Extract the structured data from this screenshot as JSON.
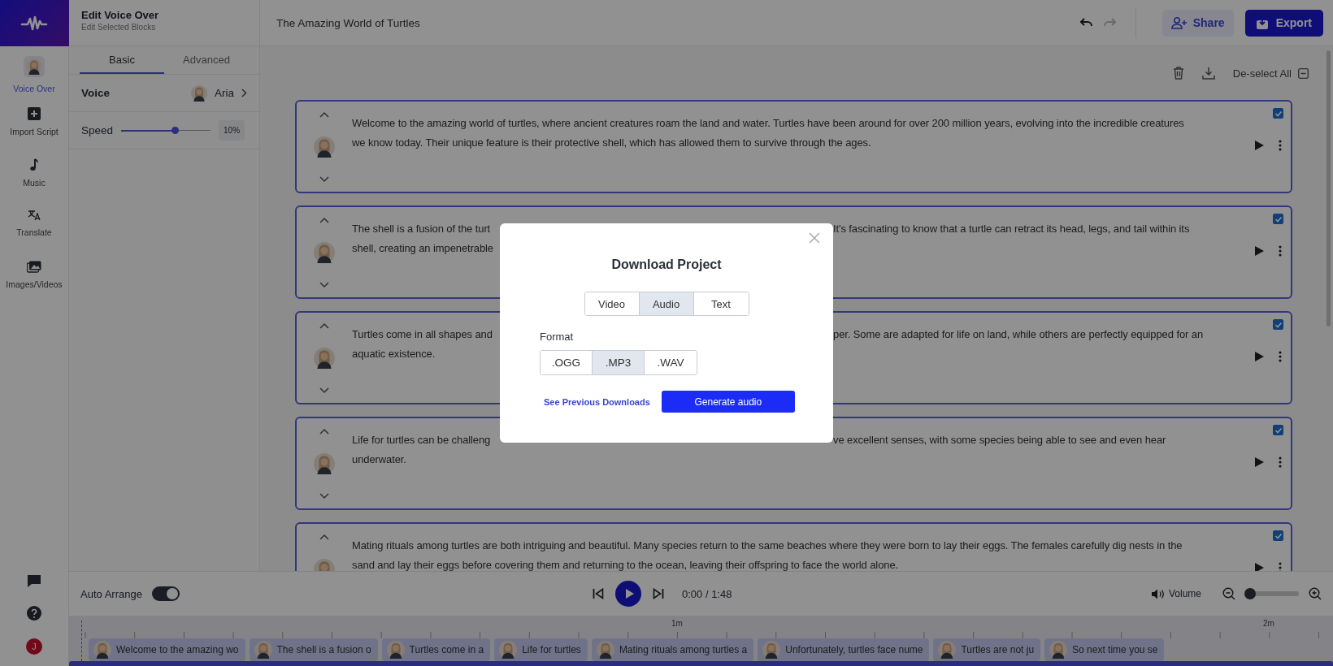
{
  "rail": [
    {
      "label": "Voice Over",
      "kind": "avatar",
      "selected": true
    },
    {
      "label": "Import Script",
      "kind": "plus",
      "selected": false
    },
    {
      "label": "Music",
      "kind": "note",
      "selected": false
    },
    {
      "label": "Translate",
      "kind": "translate",
      "selected": false
    },
    {
      "label": "Images/Videos",
      "kind": "images",
      "selected": false
    }
  ],
  "user_initial": "J",
  "panel": {
    "title": "Edit Voice Over",
    "subtitle": "Edit Selected Blocks",
    "tabs": [
      {
        "label": "Basic",
        "selected": true
      },
      {
        "label": "Advanced",
        "selected": false
      }
    ],
    "voice": {
      "label": "Voice",
      "name": "Aria"
    },
    "speed": {
      "label": "Speed",
      "level": 0.6,
      "reading": "10%"
    }
  },
  "topbar": {
    "title": "The Amazing World of Turtles",
    "share": "Share",
    "export": "Export"
  },
  "toolbar": {
    "deselect": "De-select All"
  },
  "blocks": [
    {
      "checked": true,
      "lines": [
        [
          "Welcome to the amazing world of turtles, where ancient creatures roam the land and water. Turtles have been around for over 200 million years, evolving into the incredible creatures"
        ],
        [
          "we know today. Their unique feature is their protective shell, which has allowed them to survive through the ages."
        ]
      ]
    },
    {
      "checked": true,
      "lines": [
        [
          "The shell is a fusion of the turt",
          "It's fascinating to know that a turtle can retract its head, legs, and tail within its"
        ],
        [
          "shell, creating an impenetrable"
        ]
      ]
    },
    {
      "checked": true,
      "lines": [
        [
          "Turtles come in all shapes and",
          "per. Some are adapted for life on land, while others are perfectly equipped for an"
        ],
        [
          "aquatic existence."
        ]
      ]
    },
    {
      "checked": true,
      "lines": [
        [
          "Life for turtles can be challeng",
          "ve excellent senses, with some species being able to see and even hear"
        ],
        [
          "underwater."
        ]
      ]
    },
    {
      "checked": true,
      "lines": [
        [
          "Mating rituals among turtles are both intriguing and beautiful. Many species return to the same beaches where they were born to lay their eggs. The females carefully dig nests in the"
        ],
        [
          "sand and lay their eggs before covering them and returning to the ocean, leaving their offspring to face the world alone."
        ]
      ]
    }
  ],
  "player": {
    "auto_arrange": {
      "label": "Auto Arrange",
      "on": true
    },
    "time": "0:00 / 1:48",
    "volume": "Volume",
    "zoom": {
      "level": 0.05
    }
  },
  "timeline": {
    "ticks": [
      "1m",
      "2m"
    ],
    "clips": [
      "Welcome to the amazing wo",
      "The shell is a fusion o",
      "Turtles come in a",
      "Life for turtles",
      "Mating rituals among turtles a",
      "Unfortunately, turtles face nume",
      "Turtles are not ju",
      "So next time you se"
    ]
  },
  "dialog": {
    "title": "Download Project",
    "types": [
      {
        "label": "Video",
        "selected": false
      },
      {
        "label": "Audio",
        "selected": true
      },
      {
        "label": "Text",
        "selected": false
      }
    ],
    "format_label": "Format",
    "formats": [
      {
        "label": ".OGG",
        "selected": false
      },
      {
        "label": ".MP3",
        "selected": true
      },
      {
        "label": ".WAV",
        "selected": false
      }
    ],
    "link": "See Previous Downloads",
    "button": "Generate audio"
  }
}
